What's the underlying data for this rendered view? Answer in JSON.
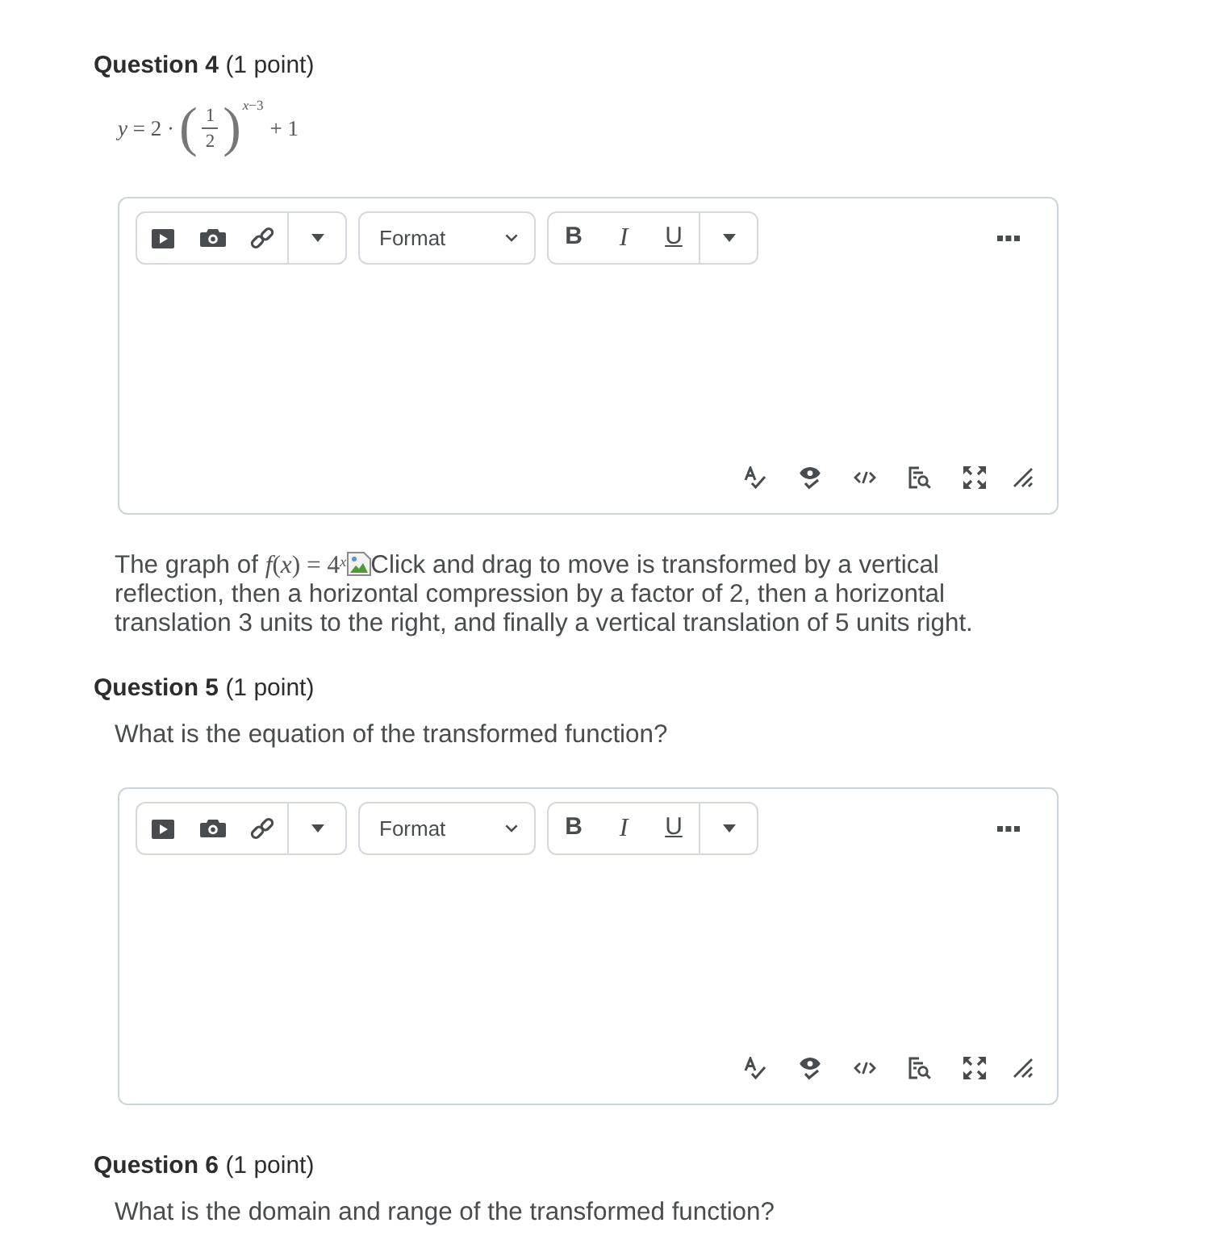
{
  "blocks": [
    {
      "kind": "heading",
      "title": "Question 4",
      "points": "(1 point)"
    },
    {
      "kind": "equation",
      "lhs": "*y* = 2 ·",
      "open": "(",
      "numerator": "1",
      "denominator": "2",
      "close": ")",
      "exponent": "*x*−3",
      "rhs": "+ 1"
    },
    {
      "kind": "editor",
      "format": "Format",
      "bold": "B",
      "italic": "I",
      "underline": "U"
    },
    {
      "kind": "paragraph",
      "before": "The graph of",
      "formula": "*f*(*x*) = 4$^{x}$",
      "image_alt": "Click and drag to move",
      "after": "is transformed by a vertical reflection, then a horizontal compression by a factor of 2, then a horizontal translation 3 units to the right, and finally a vertical translation of 5 units right."
    },
    {
      "kind": "heading",
      "title": "Question 5",
      "points": "(1 point)"
    },
    {
      "kind": "prompt",
      "text": "What is the equation of the transformed function?"
    },
    {
      "kind": "editor",
      "format": "Format",
      "bold": "B",
      "italic": "I",
      "underline": "U"
    },
    {
      "kind": "heading",
      "title": "Question 6",
      "points": "(1 point)"
    },
    {
      "kind": "prompt",
      "text": "What is the domain and range of the transformed function?"
    }
  ]
}
